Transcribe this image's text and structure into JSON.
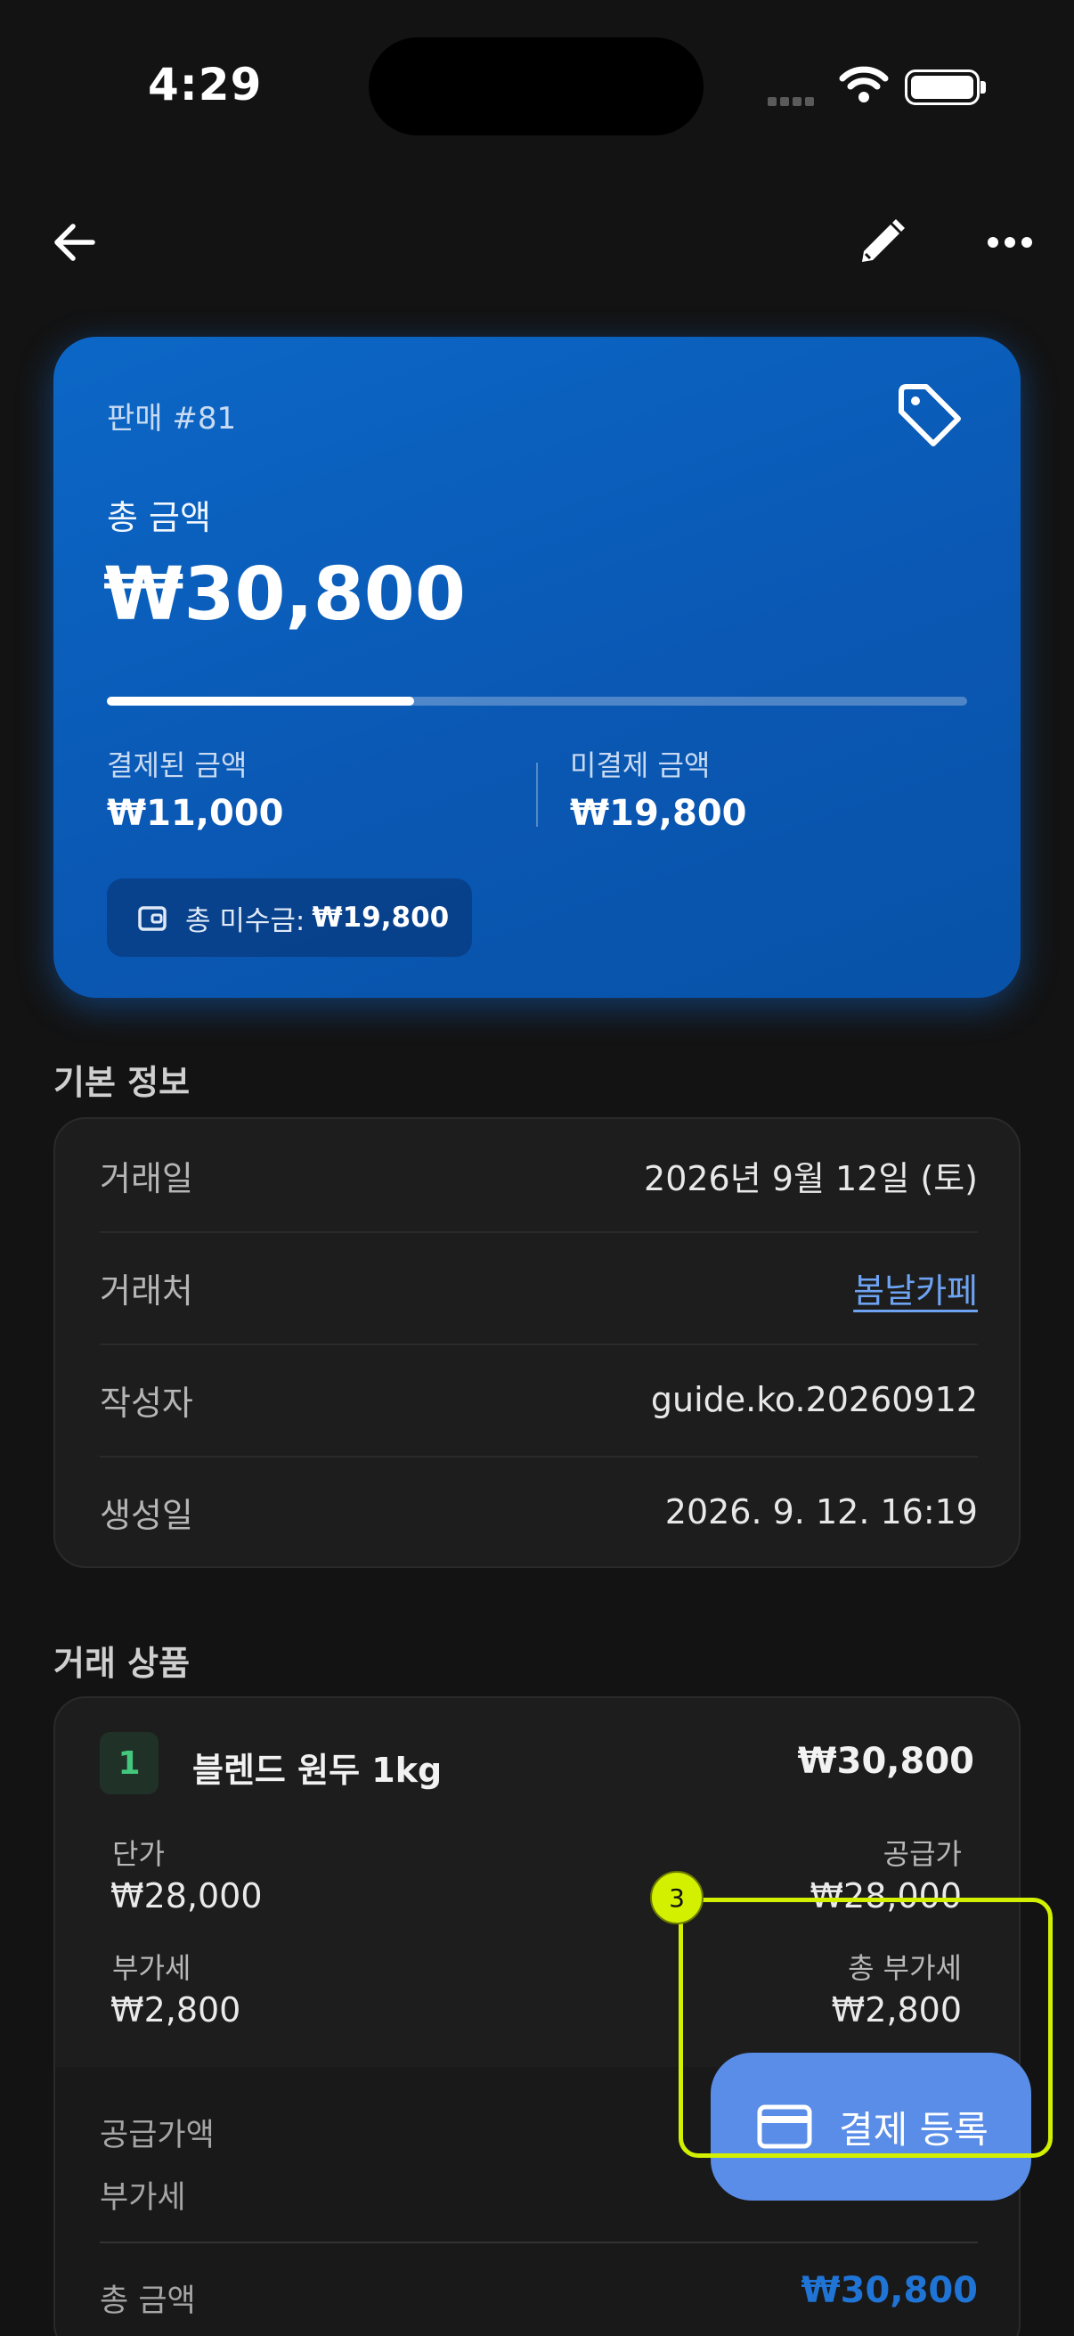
{
  "status_bar": {
    "time": "4:29"
  },
  "header": {
    "back_icon": "arrow-left-icon",
    "edit_icon": "pencil-icon",
    "more_icon": "more-horizontal-icon"
  },
  "summary": {
    "sale_id": "판매 #81",
    "total_label": "총 금액",
    "total_amount": "₩30,800",
    "paid_fraction": 0.357,
    "paid_label": "결제된 금액",
    "paid_amount": "₩11,000",
    "unpaid_label": "미결제 금액",
    "unpaid_amount": "₩19,800",
    "receivable_label": "총 미수금:",
    "receivable_amount": "₩19,800"
  },
  "basic_info": {
    "title": "기본 정보",
    "rows": [
      {
        "label": "거래일",
        "value": "2026년 9월 12일 (토)"
      },
      {
        "label": "거래처",
        "value": "봄날카페"
      },
      {
        "label": "작성자",
        "value": "guide.ko.20260912"
      },
      {
        "label": "생성일",
        "value": "2026. 9. 12. 16:19"
      }
    ]
  },
  "products": {
    "title": "거래 상품",
    "items": [
      {
        "index": "1",
        "name": "블렌드 원두 1kg",
        "total": "₩30,800",
        "unit_price_label": "단가",
        "unit_price": "₩28,000",
        "supply_label": "공급가",
        "supply": "₩28,000",
        "vat_label": "부가세",
        "vat": "₩2,800",
        "total_vat_label": "총 부가세",
        "total_vat": "₩2,800"
      }
    ],
    "summary": {
      "supply_total_label": "공급가액",
      "vat_label": "부가세",
      "total_label": "총 금액",
      "total_value": "₩30,800"
    }
  },
  "fab": {
    "label": "결제 등록",
    "icon": "credit-card-icon"
  },
  "highlight": {
    "badge": "3"
  },
  "colors": {
    "card_blue": "#0a5cb8",
    "link": "#6da3f2",
    "accent_total": "#1f74d6",
    "fab": "#5a8de8",
    "highlight": "#d2f000"
  }
}
